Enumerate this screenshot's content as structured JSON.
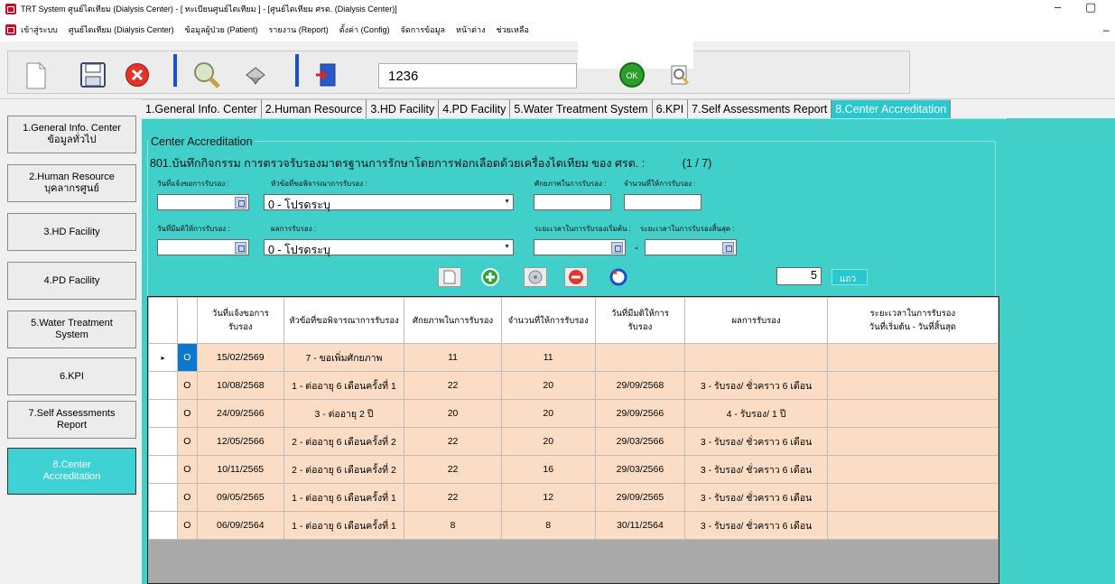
{
  "window": {
    "title": "TRT System ศูนย์ไตเทียม (Dialysis Center) - [ ทะเบียนศูนย์ไตเทียม ] - [ศูนย์ไตเทียม ศรต. (Dialysis Center)]",
    "minimize": "–",
    "restore": "▢"
  },
  "menu": {
    "items": [
      "เข้าสู่ระบบ",
      "ศูนย์ไตเทียม (Dialysis Center)",
      "ข้อมูลผู้ป่วย (Patient)",
      "รายงาน (Report)",
      "ตั้งค่า (Config)",
      "จัดการข้อมูล",
      "หน้าต่าง",
      "ช่วยเหลือ"
    ],
    "close_label": "–"
  },
  "toolbar": {
    "search_value": "1236",
    "ok_label": "OK"
  },
  "tabs": [
    "1.General Info. Center",
    "2.Human Resource",
    "3.HD Facility",
    "4.PD Facility",
    "5.Water Treatment System",
    "6.KPI",
    "7.Self Assessments Report",
    "8.Center Accreditation"
  ],
  "sidebar": [
    {
      "line1": "1.General Info. Center",
      "line2": "ข้อมูลทั่วไป"
    },
    {
      "line1": "2.Human Resource",
      "line2": "บุคลากรศูนย์"
    },
    {
      "line1": "3.HD Facility",
      "line2": ""
    },
    {
      "line1": "4.PD Facility",
      "line2": ""
    },
    {
      "line1": "5.Water Treatment",
      "line2": "System"
    },
    {
      "line1": "6.KPI",
      "line2": ""
    },
    {
      "line1": "7.Self Assessments",
      "line2": "Report"
    },
    {
      "line1": "8.Center",
      "line2": "Accreditation"
    }
  ],
  "form": {
    "legend": "Center Accreditation",
    "heading": "801.บันทึกกิจกรรม การตรวจรับรองมาตรฐานการรักษาโดยการฟอกเลือดด้วยเครื่องไตเทียม ของ ศรต. :",
    "page_indicator": "(1 / 7)",
    "labels": {
      "request_date": "วันที่แจ้งขอการรับรอง :",
      "topic": "หัวข้อที่ขอพิจารณาการรับรอง :",
      "capacity": "ศักยภาพในการรับรอง :",
      "approved_count": "จำนวนที่ให้การรับรอง :",
      "decision_date": "วันที่มีมติให้การรับรอง :",
      "result": "ผลการรับรอง :",
      "period_start": "ระยะเวลาในการรับรองเริ่มต้น :",
      "period_end": "ระยะเวลาในการรับรองสิ้นสุด :"
    },
    "topic_value": "0 - โปรดระบุ",
    "result_value": "0 - โปรดระบุ",
    "rows_count": "5",
    "rows_label": "แถว",
    "dash": "-"
  },
  "grid": {
    "headers": [
      "",
      "",
      "วันที่แจ้งขอการ\nรับรอง",
      "หัวข้อที่ขอพิจารณาการรับรอง",
      "ศักยภาพในการรับรอง",
      "จำนวนที่ให้การรับรอง",
      "วันที่มีมติให้การ\nรับรอง",
      "ผลการรับรอง",
      "ระยะเวลาในการรับรอง\nวันที่เริ่มต้น - วันที่สิ้นสุด"
    ],
    "row_pointer": "▸",
    "rows": [
      {
        "o": "O",
        "request_date": "15/02/2569",
        "topic": "7 - ขอเพิ่มศักยภาพ",
        "capacity": "11",
        "approved": "11",
        "decision_date": "",
        "result": "",
        "period": ""
      },
      {
        "o": "O",
        "request_date": "10/08/2568",
        "topic": "1 - ต่ออายุ 6 เดือนครั้งที่ 1",
        "capacity": "22",
        "approved": "20",
        "decision_date": "29/09/2568",
        "result": "3 - รับรอง/ ชั่วคราว 6 เดือน",
        "period": ""
      },
      {
        "o": "O",
        "request_date": "24/09/2566",
        "topic": "3 - ต่ออายุ 2 ปี",
        "capacity": "20",
        "approved": "20",
        "decision_date": "29/09/2566",
        "result": "4 - รับรอง/ 1 ปี",
        "period": ""
      },
      {
        "o": "O",
        "request_date": "12/05/2566",
        "topic": "2 - ต่ออายุ 6 เดือนครั้งที่ 2",
        "capacity": "22",
        "approved": "20",
        "decision_date": "29/03/2566",
        "result": "3 - รับรอง/ ชั่วคราว 6 เดือน",
        "period": ""
      },
      {
        "o": "O",
        "request_date": "10/11/2565",
        "topic": "2 - ต่ออายุ 6 เดือนครั้งที่ 2",
        "capacity": "22",
        "approved": "16",
        "decision_date": "29/03/2566",
        "result": "3 - รับรอง/ ชั่วคราว 6 เดือน",
        "period": ""
      },
      {
        "o": "O",
        "request_date": "09/05/2565",
        "topic": "1 - ต่ออายุ 6 เดือนครั้งที่ 1",
        "capacity": "22",
        "approved": "12",
        "decision_date": "29/09/2565",
        "result": "3 - รับรอง/ ชั่วคราว 6 เดือน",
        "period": ""
      },
      {
        "o": "O",
        "request_date": "06/09/2564",
        "topic": "1 - ต่ออายุ 6 เดือนครั้งที่ 1",
        "capacity": "8",
        "approved": "8",
        "decision_date": "30/11/2564",
        "result": "3 - รับรอง/ ชั่วคราว 6 เดือน",
        "period": ""
      }
    ]
  },
  "colors": {
    "panel": "#40cfc9",
    "active_tab": "#28c8d0",
    "row_fill": "#fbdcc4",
    "selected_cell": "#0a77d0",
    "separator": "#1a4fd0"
  }
}
